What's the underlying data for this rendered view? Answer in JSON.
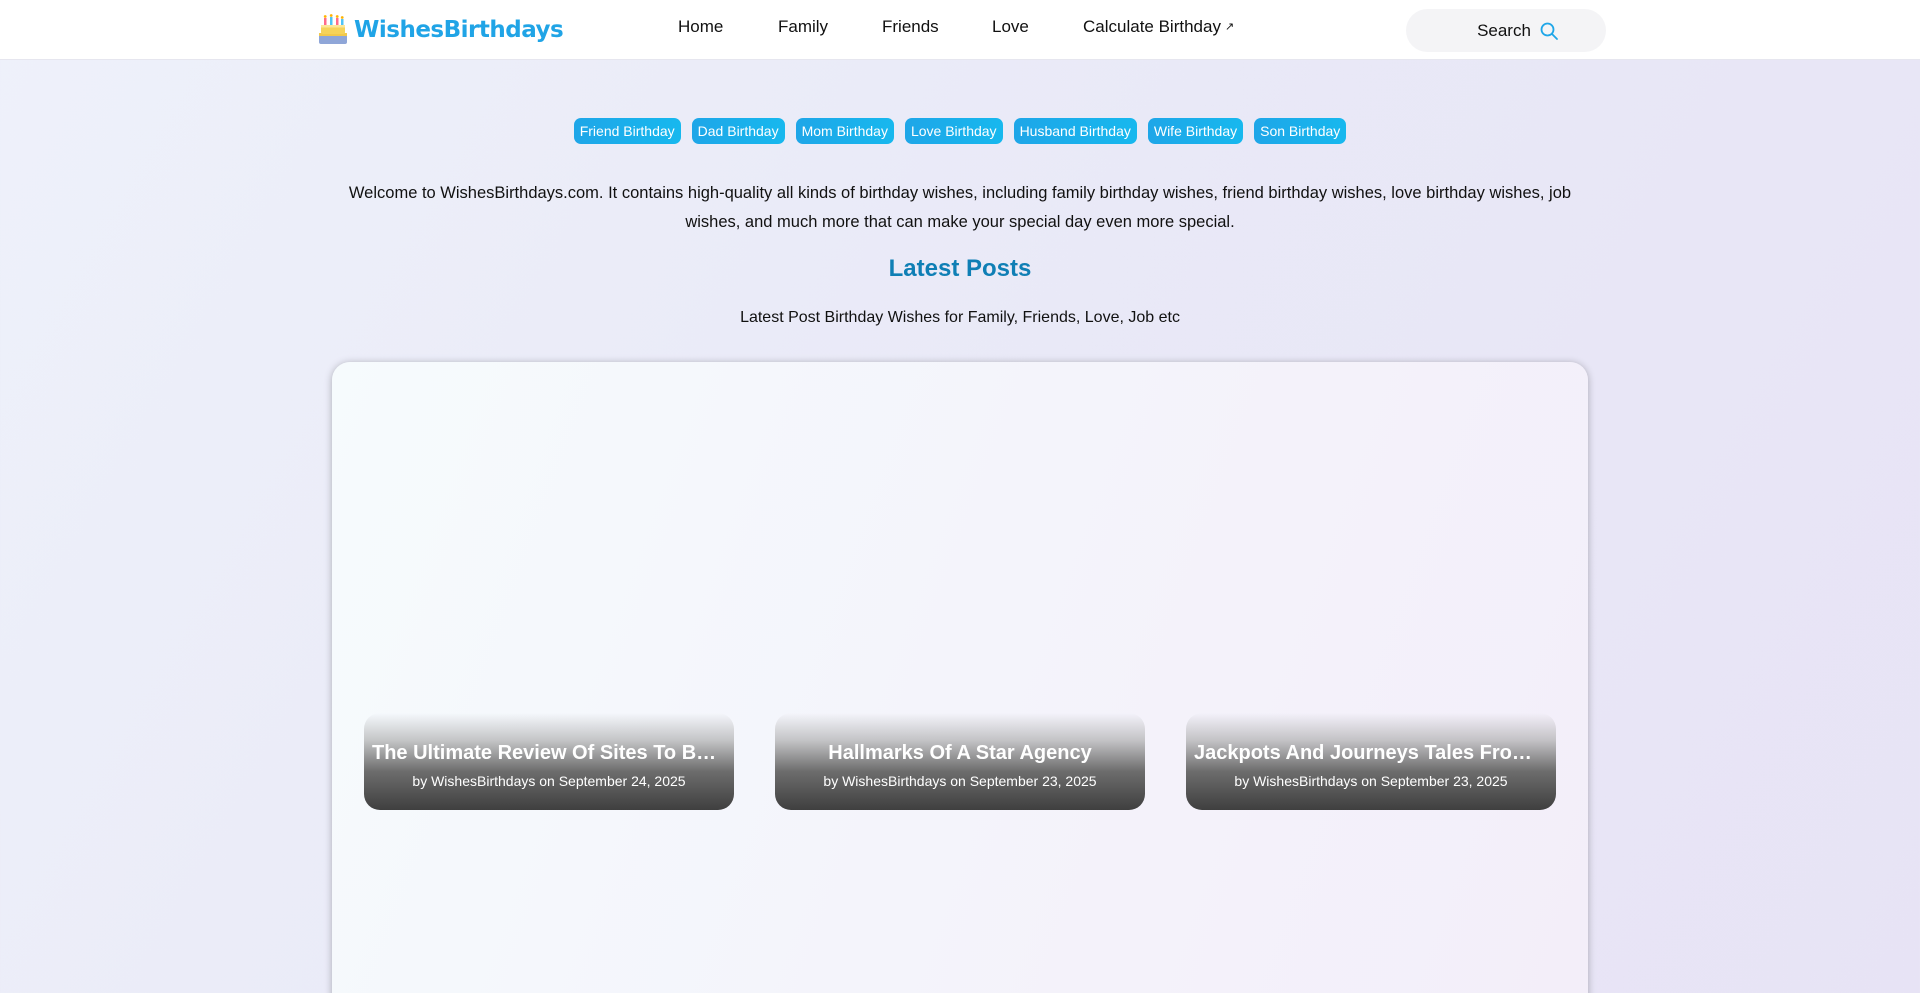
{
  "header": {
    "logo_text": "WishesBirthdays",
    "nav": [
      {
        "label": "Home"
      },
      {
        "label": "Family"
      },
      {
        "label": "Friends"
      },
      {
        "label": "Love"
      },
      {
        "label": "Calculate Birthday",
        "external_icon": "↗"
      }
    ],
    "search_label": "Search"
  },
  "tags": [
    "Friend Birthday",
    "Dad Birthday",
    "Mom Birthday",
    "Love Birthday",
    "Husband Birthday",
    "Wife Birthday",
    "Son Birthday"
  ],
  "intro": "Welcome to WishesBirthdays.com. It contains high-quality all kinds of birthday wishes, including family birthday wishes, friend birthday wishes, love birthday wishes, job wishes, and much more that can make your special day even more special.",
  "latest": {
    "title": "Latest Posts",
    "subtitle": "Latest Post Birthday Wishes for Family, Friends, Love, Job etc",
    "posts": [
      {
        "title": "The Ultimate Review Of Sites To Buy Youtube Subscribers",
        "meta": "by WishesBirthdays on September 24, 2025"
      },
      {
        "title": "Hallmarks Of A Star Agency",
        "meta": "by WishesBirthdays on September 23, 2025"
      },
      {
        "title": "Jackpots And Journeys Tales From The Casino Floor",
        "meta": "by WishesBirthdays on September 23, 2025"
      }
    ]
  },
  "colors": {
    "brand": "#20a4e6",
    "tag_bg": "#1ea6e8",
    "section_title": "#0f7fb5"
  },
  "icons": {
    "logo": "birthday-cake-icon",
    "search": "search-icon",
    "external": "external-link-icon"
  }
}
